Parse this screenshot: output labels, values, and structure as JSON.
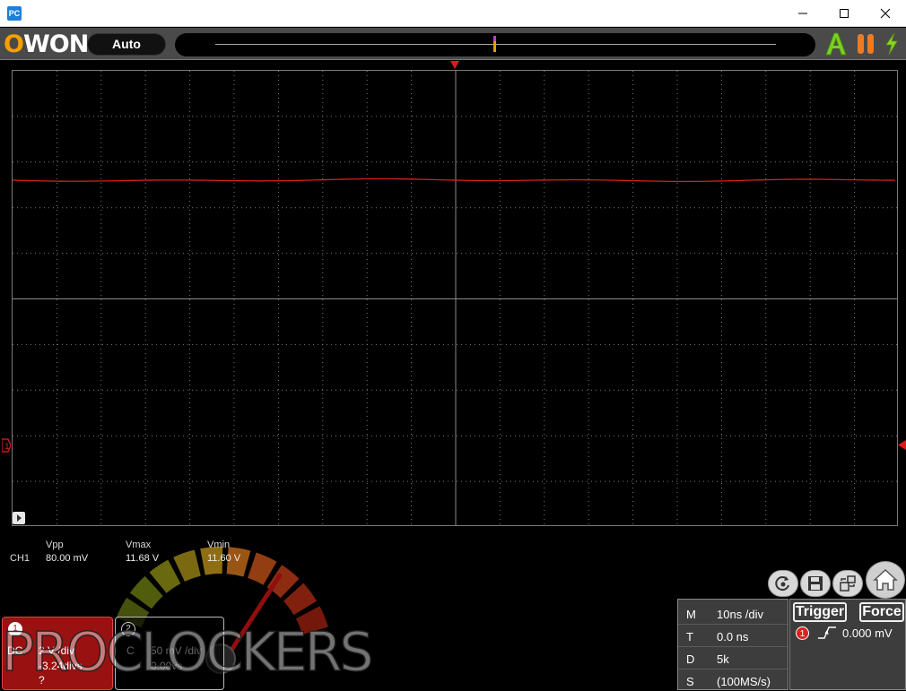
{
  "window": {
    "icon_label": "PC",
    "controls": [
      "minimize",
      "maximize",
      "close"
    ]
  },
  "toolbar": {
    "logo_o": "O",
    "logo_rest": "WON",
    "mode_label": "Auto"
  },
  "measurements": {
    "channel": "CH1",
    "items": [
      {
        "label": "Vpp",
        "value": "80.00 mV"
      },
      {
        "label": "Vmax",
        "value": "11.68 V"
      },
      {
        "label": "Vmin",
        "value": "11.60 V"
      }
    ]
  },
  "ch1": {
    "number": "1",
    "coupling": "DC",
    "scale": "2 V /div",
    "offset": "-3.24divs",
    "probe": "?"
  },
  "ch2": {
    "number": "2",
    "coupling": "C",
    "scale": "50 mV /div",
    "offset": "0.00vs"
  },
  "watermark": "PROCLOCKERS",
  "timebase": {
    "rows": [
      {
        "key": "M",
        "value": "10ns /div"
      },
      {
        "key": "T",
        "value": "0.0 ns"
      },
      {
        "key": "D",
        "value": "5k"
      },
      {
        "key": "S",
        "value": "(100MS/s)"
      }
    ]
  },
  "trigger": {
    "trigger_label": "Trigger",
    "force_label": "Force",
    "source": "1",
    "level": "0.000 mV"
  },
  "colors": {
    "trace": "#d21e1e",
    "logo_accent": "#f4a000",
    "grid": "#7a7a7a"
  }
}
